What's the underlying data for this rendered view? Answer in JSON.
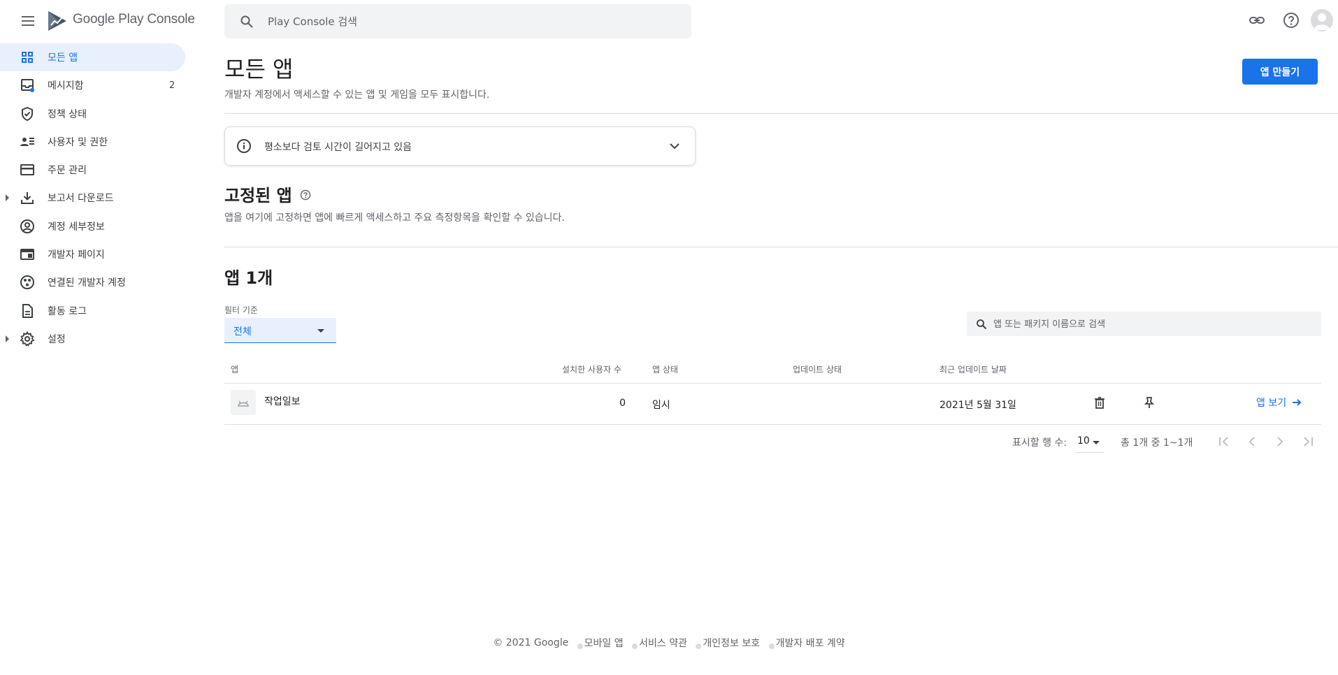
{
  "app_title": "Google Play Console",
  "search": {
    "placeholder": "Play Console 검색"
  },
  "sidebar": {
    "items": [
      {
        "label": "모든 앱",
        "icon": "grid-icon",
        "active": true
      },
      {
        "label": "메시지함",
        "icon": "inbox-icon",
        "badge": "2"
      },
      {
        "label": "정책 상태",
        "icon": "shield-check-icon"
      },
      {
        "label": "사용자 및 권한",
        "icon": "users-list-icon"
      },
      {
        "label": "주문 관리",
        "icon": "credit-card-icon"
      },
      {
        "label": "보고서 다운로드",
        "icon": "download-icon",
        "expandable": true
      },
      {
        "label": "계정 세부정보",
        "icon": "account-circle-icon"
      },
      {
        "label": "개발자 페이지",
        "icon": "web-page-icon"
      },
      {
        "label": "연결된 개발자 계정",
        "icon": "linked-accounts-icon"
      },
      {
        "label": "활동 로그",
        "icon": "document-icon"
      },
      {
        "label": "설정",
        "icon": "gear-icon",
        "expandable": true
      }
    ]
  },
  "main": {
    "title": "모든 앱",
    "subtitle": "개발자 계정에서 액세스할 수 있는 앱 및 게임을 모두 표시합니다.",
    "create_button": "앱 만들기",
    "notice": "평소보다 검토 시간이 길어지고 있음",
    "pinned": {
      "title": "고정된 앱",
      "subtitle": "앱을 여기에 고정하면 앱에 빠르게 액세스하고 주요 측정항목을 확인할 수 있습니다."
    },
    "apps": {
      "title": "앱 1개",
      "filter_label": "필터 기준",
      "filter_value": "전체",
      "search_placeholder": "앱 또는 패키지 이름으로 검색",
      "columns": [
        "앱",
        "설치한 사용자 수",
        "앱 상태",
        "업데이트 상태",
        "최근 업데이트 날짜"
      ],
      "rows": [
        {
          "name": "작업일보",
          "installs": "0",
          "status": "임시",
          "update_status": "",
          "last_updated": "2021년 5월 31일",
          "view_label": "앱 보기"
        }
      ]
    },
    "pagination": {
      "rows_label": "표시할 행 수:",
      "rows_value": "10",
      "range": "총 1개 중 1~1개"
    }
  },
  "footer": {
    "copyright": "© 2021 Google",
    "links": [
      "모바일 앱",
      "서비스 약관",
      "개인정보 보호",
      "개발자 배포 계약"
    ]
  },
  "colors": {
    "accent": "#1a73e8",
    "active_bg": "#e8f0fe",
    "badge_dot": "#1a73e8"
  }
}
